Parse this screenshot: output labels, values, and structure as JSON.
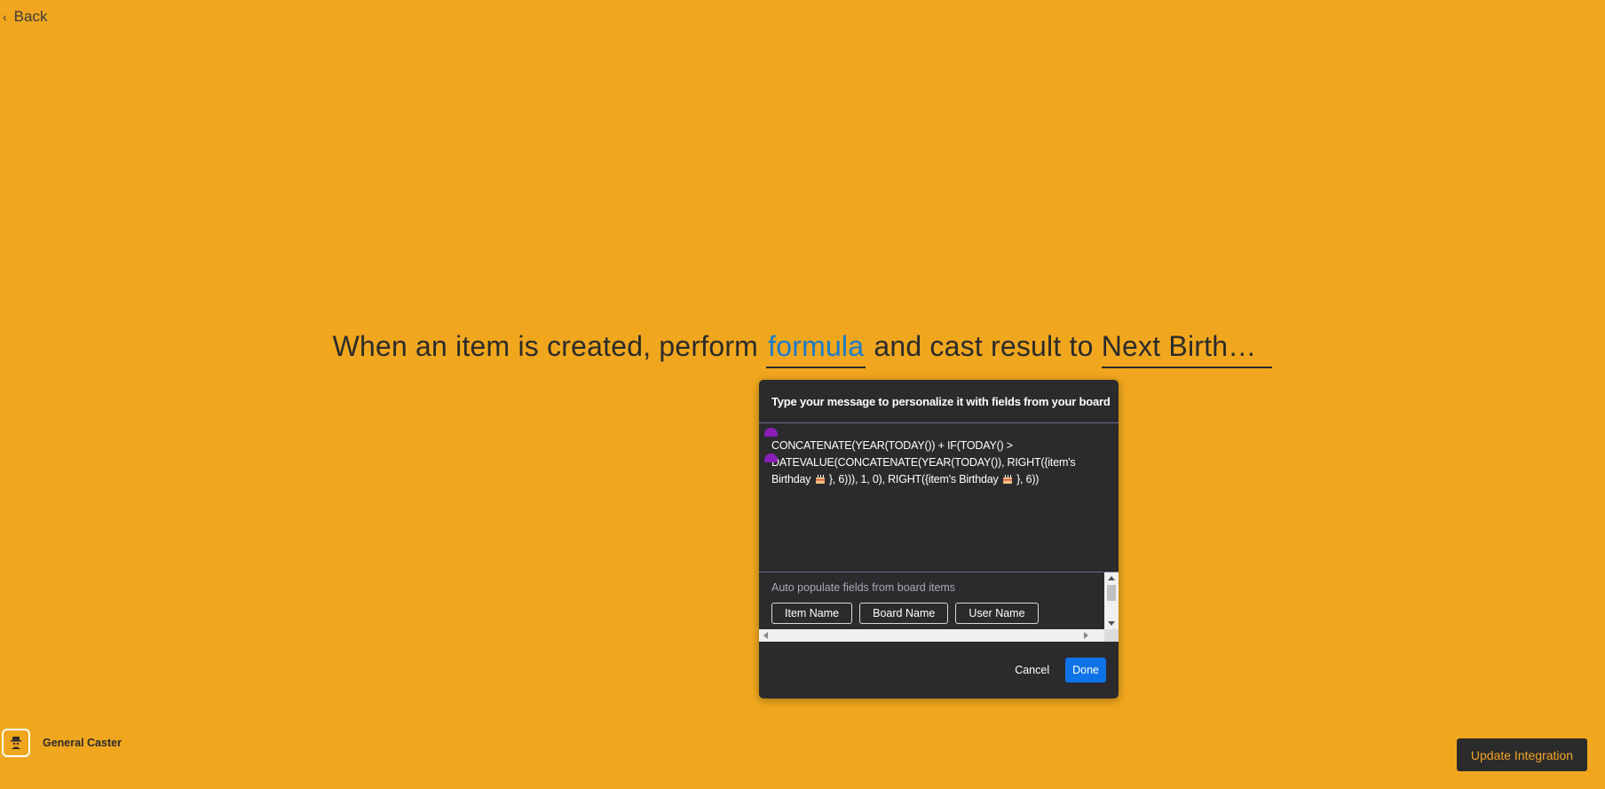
{
  "nav": {
    "back_label": "Back"
  },
  "recipe": {
    "prefix": "When an item is created, perform",
    "formula_field": "formula",
    "middle": "and cast result to",
    "target_field": "Next Birth…"
  },
  "modal": {
    "title": "Type your message to personalize it with fields from your board",
    "formula_line1": "CONCATENATE(YEAR(TODAY()) + IF(TODAY() >",
    "formula_line2": "DATEVALUE(CONCATENATE(YEAR(TODAY()), RIGHT({item's",
    "formula_line3_a": "Birthday",
    "formula_line3_b": "}, 6))), 1, 0), RIGHT({item's Birthday",
    "formula_line3_c": "}, 6))",
    "fields_label": "Auto populate fields from board items",
    "chips": [
      "Item Name",
      "Board Name",
      "User Name"
    ],
    "cancel_label": "Cancel",
    "done_label": "Done"
  },
  "brand": {
    "name": "General Caster"
  },
  "actions": {
    "update_label": "Update Integration"
  },
  "colors": {
    "background": "#f1a71d",
    "modal": "#2b2b2e",
    "accent_link": "#1b7bc8",
    "primary_button": "#0f73e8",
    "marker": "#8b1fb8"
  },
  "icons": {
    "back": "chevron-left-icon",
    "cake": "birthday-cake-icon",
    "logo": "caster-logo-icon"
  }
}
